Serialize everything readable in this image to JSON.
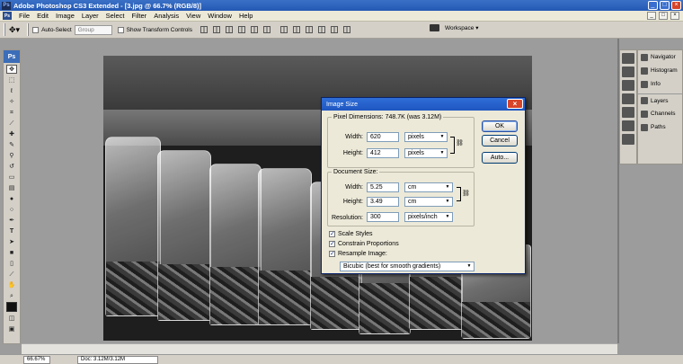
{
  "titlebar": {
    "title": "Adobe Photoshop CS3 Extended - [3.jpg @ 66.7% (RGB/8)]",
    "app_icon": "Ps",
    "buttons": [
      "_",
      "□",
      "×"
    ]
  },
  "menubar": {
    "app_icon": "Ps",
    "items": [
      "File",
      "Edit",
      "Image",
      "Layer",
      "Select",
      "Filter",
      "Analysis",
      "View",
      "Window",
      "Help"
    ]
  },
  "options": {
    "auto_select_label": "Auto-Select",
    "auto_select_value": "Group",
    "show_transform_label": "Show Transform Controls",
    "workspace_label": "Workspace ▾"
  },
  "toolbox": {
    "header": "Ps"
  },
  "panels": {
    "items": [
      "Navigator",
      "Histogram",
      "Info",
      "Layers",
      "Channels",
      "Paths"
    ]
  },
  "status": {
    "zoom": "66.67%",
    "doc": "Doc: 3.12M/3.12M"
  },
  "dialog": {
    "title": "Image Size",
    "close": "×",
    "pixel_dimensions": {
      "legend": "Pixel Dimensions:",
      "size_text": "748.7K (was 3.12M)",
      "width_label": "Width:",
      "width_value": "620",
      "width_unit": "pixels",
      "height_label": "Height:",
      "height_value": "412",
      "height_unit": "pixels"
    },
    "document_size": {
      "legend": "Document Size:",
      "width_label": "Width:",
      "width_value": "5.25",
      "width_unit": "cm",
      "height_label": "Height:",
      "height_value": "3.49",
      "height_unit": "cm",
      "resolution_label": "Resolution:",
      "resolution_value": "300",
      "resolution_unit": "pixels/inch"
    },
    "checkboxes": [
      {
        "label": "Scale Styles",
        "checked": true
      },
      {
        "label": "Constrain Proportions",
        "checked": true
      },
      {
        "label": "Resample Image:",
        "checked": true
      }
    ],
    "resample_method": "Bicubic (best for smooth gradients)",
    "buttons": {
      "ok": "OK",
      "cancel": "Cancel",
      "auto": "Auto..."
    }
  }
}
